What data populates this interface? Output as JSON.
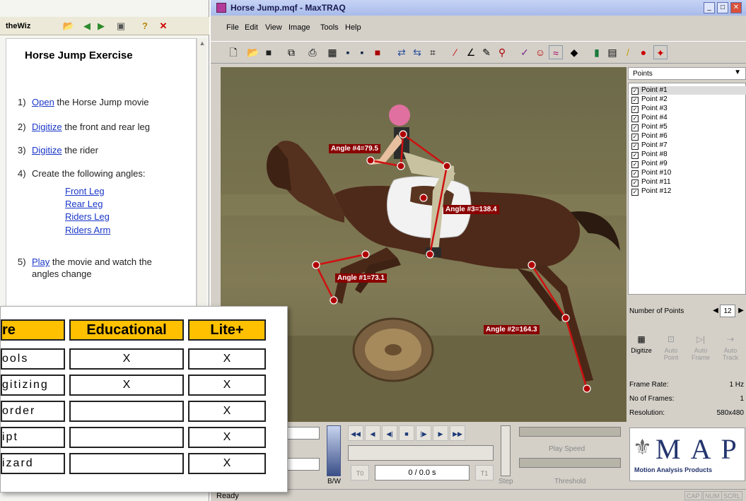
{
  "wizard": {
    "pane_title": "theWiz",
    "heading": "Horse Jump Exercise",
    "steps": [
      {
        "num": "1)",
        "link": "Open",
        "rest": " the Horse Jump movie"
      },
      {
        "num": "2)",
        "link": "Digitize",
        "rest": " the front and rear leg"
      },
      {
        "num": "3)",
        "link": "Digitize",
        "rest": " the rider"
      },
      {
        "num": "4)",
        "link": "",
        "rest": "Create the following angles:"
      },
      {
        "num": "5)",
        "link": "Play",
        "rest": " the movie and watch the"
      }
    ],
    "step5_line2": "angles change",
    "angle_links": [
      "Front Leg",
      "Rear Leg",
      "Riders Leg",
      "Riders Arm"
    ]
  },
  "app": {
    "title": "Horse Jump.mqf - MaxTRAQ",
    "menu": [
      "File",
      "Edit",
      "View",
      "Image",
      "Tools",
      "Help"
    ],
    "points_header": "Points",
    "points": [
      "Point #1",
      "Point #2",
      "Point #3",
      "Point #4",
      "Point #5",
      "Point #6",
      "Point #7",
      "Point #8",
      "Point #9",
      "Point #10",
      "Point #11",
      "Point #12"
    ],
    "selected_point": 0,
    "number_of_points_label": "Number of Points",
    "number_of_points": "12",
    "digitize_buttons": [
      "Digitize",
      "Auto Point",
      "Auto Frame",
      "Auto Track"
    ],
    "frame_rate_label": "Frame Rate:",
    "frame_rate": "1 Hz",
    "frames_label": "No of Frames:",
    "frames": "1",
    "resolution_label": "Resolution:",
    "resolution": "580x480",
    "logo_text": "MAP",
    "logo_sub": "Motion Analysis Products",
    "angles": [
      "Angle #4=79.5",
      "Angle #3=138.4",
      "Angle #1=73.1",
      "Angle #2=164.3"
    ],
    "markers": [
      "10",
      "11",
      "12",
      "9",
      "8",
      "7",
      "6",
      "4",
      "5",
      "3",
      "2",
      "1"
    ],
    "bw_label": "B/W",
    "t0": "T0",
    "t1": "T1",
    "time": "0 / 0.0 s",
    "play_speed": "Play Speed",
    "threshold": "Threshold",
    "step": "Step",
    "status": "Ready",
    "indicators": [
      "CAP",
      "NUM",
      "SCRL"
    ]
  },
  "features": {
    "headers": [
      "re",
      "Educational",
      "Lite+"
    ],
    "rows": [
      {
        "name": "ools",
        "edu": "X",
        "lite": "X"
      },
      {
        "name": "gitizing",
        "edu": "X",
        "lite": "X"
      },
      {
        "name": "order",
        "edu": "",
        "lite": "X"
      },
      {
        "name": "ipt",
        "edu": "",
        "lite": "X"
      },
      {
        "name": "izard",
        "edu": "",
        "lite": "X"
      }
    ]
  },
  "colors": {
    "accent": "#ffc000",
    "link": "#1a37c8",
    "angle_tag": "#8a0000"
  }
}
